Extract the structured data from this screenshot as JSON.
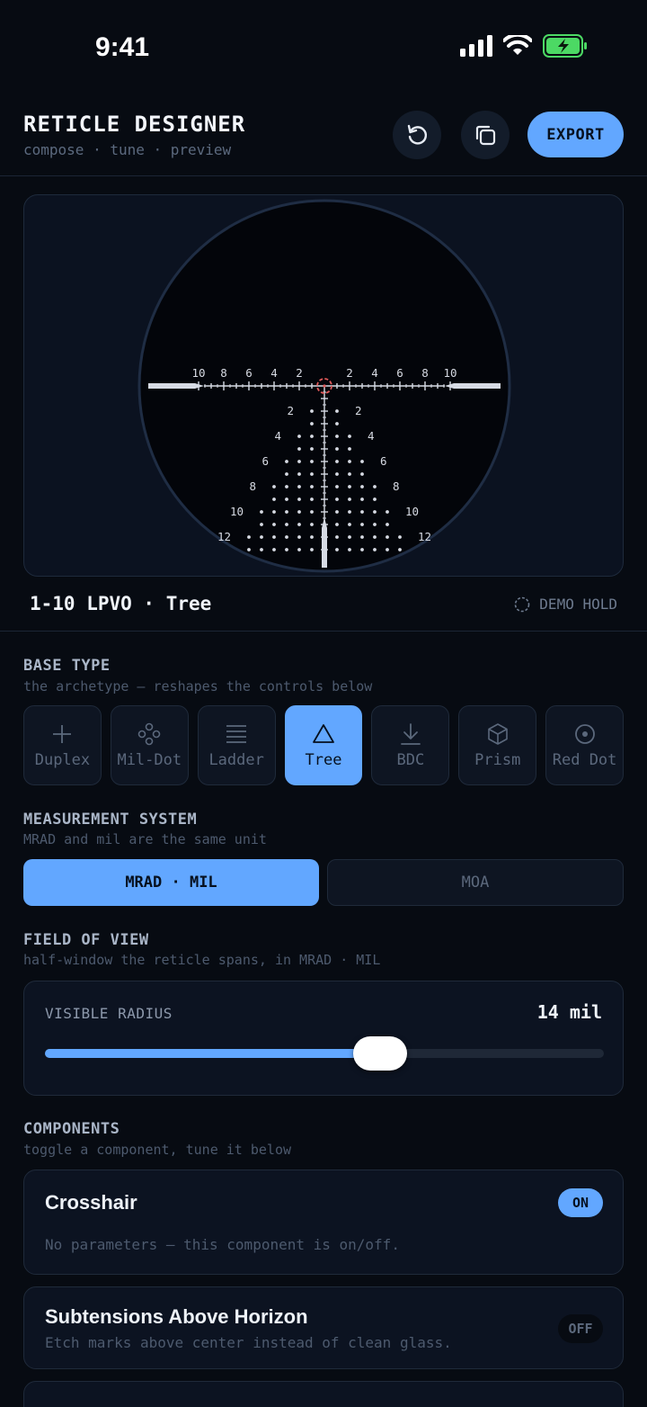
{
  "status": {
    "time": "9:41"
  },
  "header": {
    "title": "RETICLE DESIGNER",
    "subtitle": "compose · tune · preview",
    "export_label": "EXPORT"
  },
  "preview": {
    "label": "1-10 LPVO · Tree",
    "demo_hold": "DEMO HOLD",
    "horizontal_ticks": [
      "10",
      "8",
      "6",
      "4",
      "2",
      "2",
      "4",
      "6",
      "8",
      "10"
    ],
    "tree_rows": [
      "2",
      "4",
      "6",
      "8",
      "10",
      "12"
    ]
  },
  "base_type": {
    "title": "BASE TYPE",
    "hint": "the archetype — reshapes the controls below",
    "items": [
      {
        "label": "Duplex",
        "icon": "plus-icon",
        "active": false
      },
      {
        "label": "Mil-Dot",
        "icon": "dots-icon",
        "active": false
      },
      {
        "label": "Ladder",
        "icon": "ladder-icon",
        "active": false
      },
      {
        "label": "Tree",
        "icon": "triangle-icon",
        "active": true
      },
      {
        "label": "BDC",
        "icon": "arrow-down-icon",
        "active": false
      },
      {
        "label": "Prism",
        "icon": "cube-icon",
        "active": false
      },
      {
        "label": "Red Dot",
        "icon": "target-icon",
        "active": false
      }
    ]
  },
  "measurement": {
    "title": "MEASUREMENT SYSTEM",
    "hint": "MRAD and mil are the same unit",
    "options": [
      "MRAD · MIL",
      "MOA"
    ],
    "selected": "MRAD · MIL"
  },
  "fov": {
    "title": "FIELD OF VIEW",
    "hint": "half-window the reticle spans, in MRAD · MIL",
    "label": "VISIBLE RADIUS",
    "value": "14 mil",
    "slider_fraction": 0.6
  },
  "components": {
    "title": "COMPONENTS",
    "hint": "toggle a component, tune it below",
    "items": [
      {
        "name": "Crosshair",
        "desc": "No parameters — this component is on/off.",
        "state": "ON"
      },
      {
        "name": "Subtensions Above Horizon",
        "desc": "Etch marks above center instead of clean glass.",
        "state": "OFF"
      }
    ]
  },
  "colors": {
    "accent": "#62a7ff",
    "background": "#070b12",
    "center_ring": "#e05a5a"
  }
}
